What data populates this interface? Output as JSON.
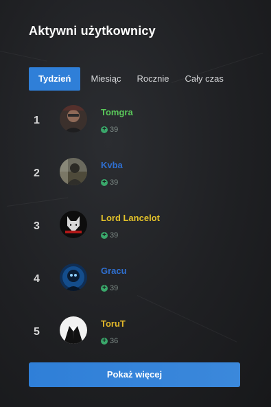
{
  "widget": {
    "title": "Aktywni użytkownicy",
    "tabs": [
      "Tydzień",
      "Miesiąc",
      "Rocznie",
      "Cały czas"
    ],
    "active_tab": 0,
    "users": [
      {
        "rank": "1",
        "name": "Tomgra",
        "points": "39",
        "name_color": "#5ac85a"
      },
      {
        "rank": "2",
        "name": "Kvba",
        "points": "39",
        "name_color": "#2f6fd0"
      },
      {
        "rank": "3",
        "name": "Lord Lancelot",
        "points": "39",
        "name_color": "#e2c12a"
      },
      {
        "rank": "4",
        "name": "Gracu",
        "points": "39",
        "name_color": "#2f6fd0"
      },
      {
        "rank": "5",
        "name": "ToruT",
        "points": "36",
        "name_color": "#e2b72a"
      }
    ],
    "more_label": "Pokaż więcej"
  },
  "colors": {
    "accent": "#2f7fd8",
    "points_icon": "#3aa86b"
  },
  "icons": {
    "points": "plus-circle-icon"
  }
}
